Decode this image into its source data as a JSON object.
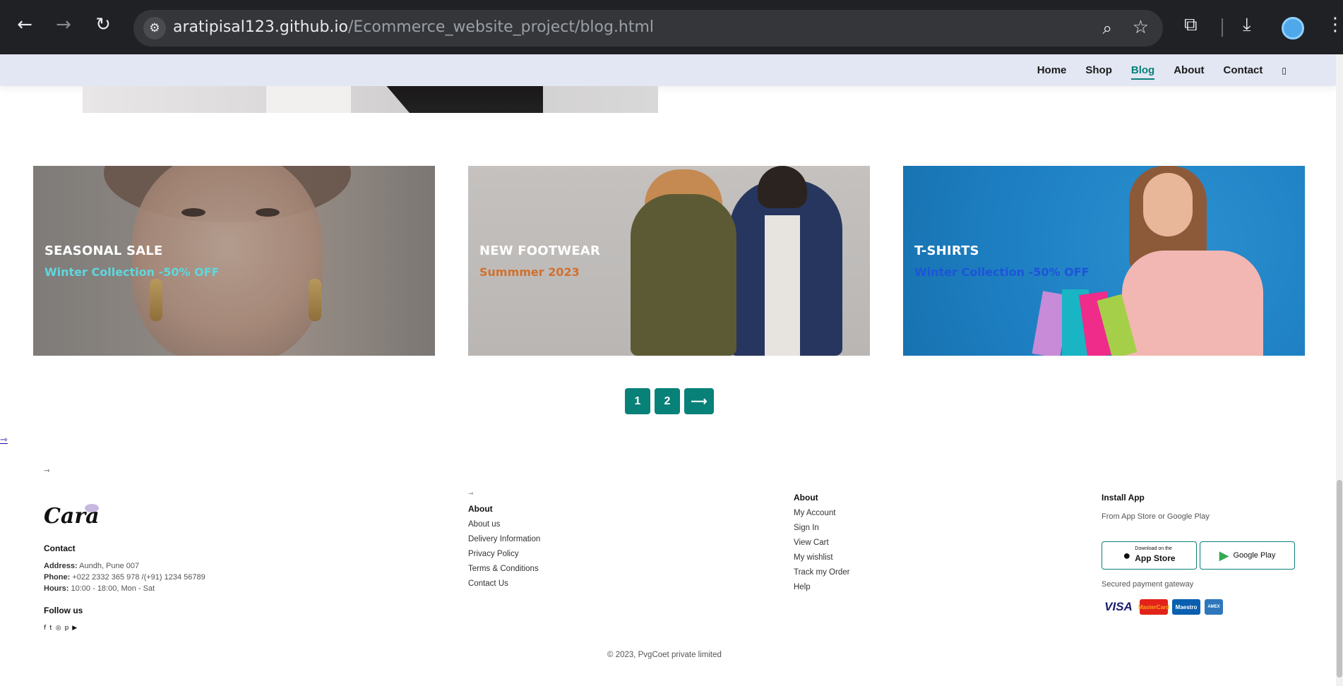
{
  "browser": {
    "url_host": "aratipisal123.github.io",
    "url_path": "/Ecommerce_website_project/blog.html"
  },
  "nav": {
    "items": [
      "Home",
      "Shop",
      "Blog",
      "About",
      "Contact"
    ],
    "active": "Blog",
    "bag_icon": "shopping-bag-icon"
  },
  "banners": [
    {
      "title": "SEASONAL SALE",
      "subtitle": "Winter Collection -50% OFF",
      "subtitle_color": "#5fd7df"
    },
    {
      "title": "NEW FOOTWEAR",
      "subtitle": "Summmer 2023",
      "subtitle_color": "#d0712f"
    },
    {
      "title": "T-SHIRTS",
      "subtitle": "Winter Collection -50% OFF",
      "subtitle_color": "#1d54d9"
    }
  ],
  "pagination": {
    "pages": [
      "1",
      "2"
    ],
    "next": "⟶",
    "color": "#088178"
  },
  "stray_arrows": [
    "⇾",
    "⇾"
  ],
  "footer": {
    "logo": "Cara",
    "contact_heading": "Contact",
    "address_label": "Address:",
    "address": "Aundh, Pune 007",
    "phone_label": "Phone:",
    "phone": "+022 2332 365 978 /(+91) 1234 56789",
    "hours_label": "Hours:",
    "hours": "10:00 - 18:00, Mon - Sat",
    "follow_heading": "Follow us",
    "col2_arrow": "⇾",
    "col2_heading": "About",
    "col2_links": [
      "About us",
      "Delivery Information",
      "Privacy Policy",
      "Terms & Conditions",
      "Contact Us"
    ],
    "col3_heading": "About",
    "col3_links": [
      "My Account",
      "Sign In",
      "View Cart",
      "My wishlist",
      "Track my Order",
      "Help"
    ],
    "install_heading": "Install App",
    "install_sub": "From App Store or Google Play",
    "app_store_small": "Download on the",
    "app_store": "App Store",
    "google_play": "Google Play",
    "gateway": "Secured payment gateway",
    "payments": [
      "VISA",
      "MasterCard",
      "Maestro",
      "AMEX"
    ],
    "copyright": "© 2023, PvgCoet private limited"
  }
}
